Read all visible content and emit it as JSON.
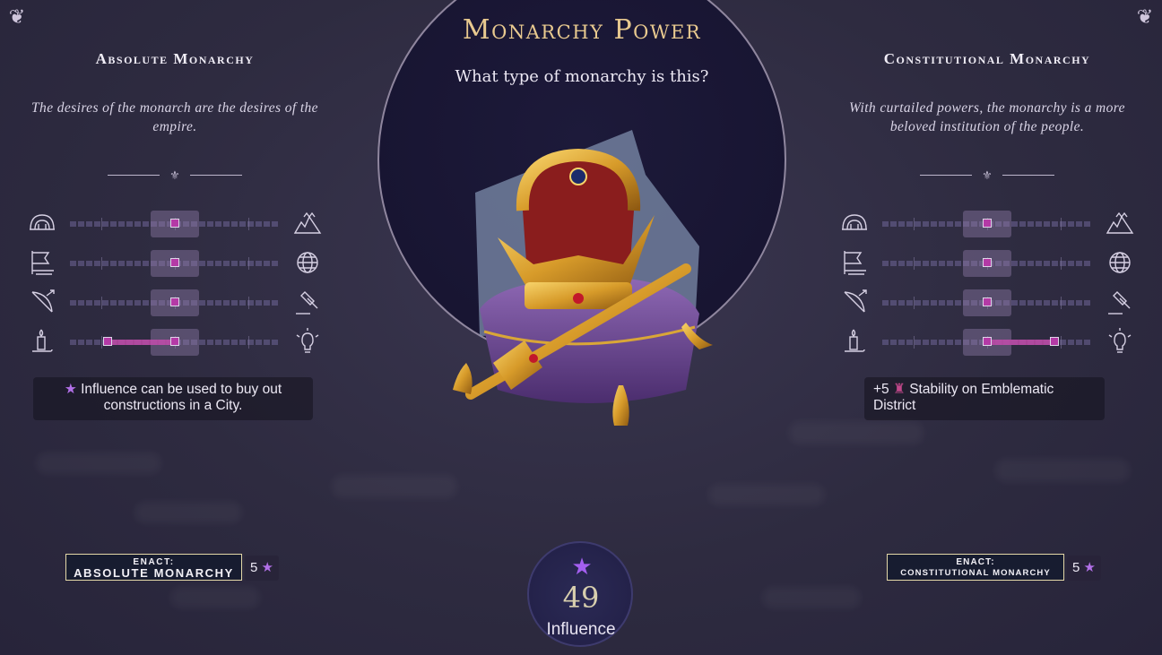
{
  "title": "Monarchy Power",
  "question": "What type of monarchy is this?",
  "left": {
    "title": "Absolute Monarchy",
    "description": "The desires of the monarch are the desires of the empire.",
    "effect_text": "Influence can be used to buy out constructions in a City.",
    "enact_line1": "ENACT:",
    "enact_line2": "ABSOLUTE MONARCHY",
    "cost": "5",
    "rows": [
      {
        "left_icon": "dome-icon",
        "right_icon": "crown-mountain-icon",
        "position": 0.5,
        "shift_to": null
      },
      {
        "left_icon": "flag-icon",
        "right_icon": "globe-icon",
        "position": 0.5,
        "shift_to": null
      },
      {
        "left_icon": "bow-arrow-icon",
        "right_icon": "gavel-icon",
        "position": 0.5,
        "shift_to": null
      },
      {
        "left_icon": "candle-icon",
        "right_icon": "lightbulb-icon",
        "position": 0.5,
        "shift_to": 0.18
      }
    ]
  },
  "right": {
    "title": "Constitutional Monarchy",
    "description": "With curtailed powers, the monarchy is a more beloved institution of the people.",
    "effect_prefix": "+5",
    "effect_text": "Stability on Emblematic District",
    "enact_line1": "ENACT:",
    "enact_line2": "CONSTITUTIONAL MONARCHY",
    "cost": "5",
    "rows": [
      {
        "left_icon": "dome-icon",
        "right_icon": "crown-mountain-icon",
        "position": 0.5,
        "shift_to": null
      },
      {
        "left_icon": "flag-icon",
        "right_icon": "globe-icon",
        "position": 0.5,
        "shift_to": null
      },
      {
        "left_icon": "bow-arrow-icon",
        "right_icon": "gavel-icon",
        "position": 0.5,
        "shift_to": null
      },
      {
        "left_icon": "candle-icon",
        "right_icon": "lightbulb-icon",
        "position": 0.5,
        "shift_to": 0.82
      }
    ]
  },
  "influence": {
    "value": "49",
    "label": "Influence"
  },
  "colors": {
    "accent_gold": "#e8c98f",
    "influence_purple": "#a45ff0",
    "track_pink": "#c04aa8"
  }
}
